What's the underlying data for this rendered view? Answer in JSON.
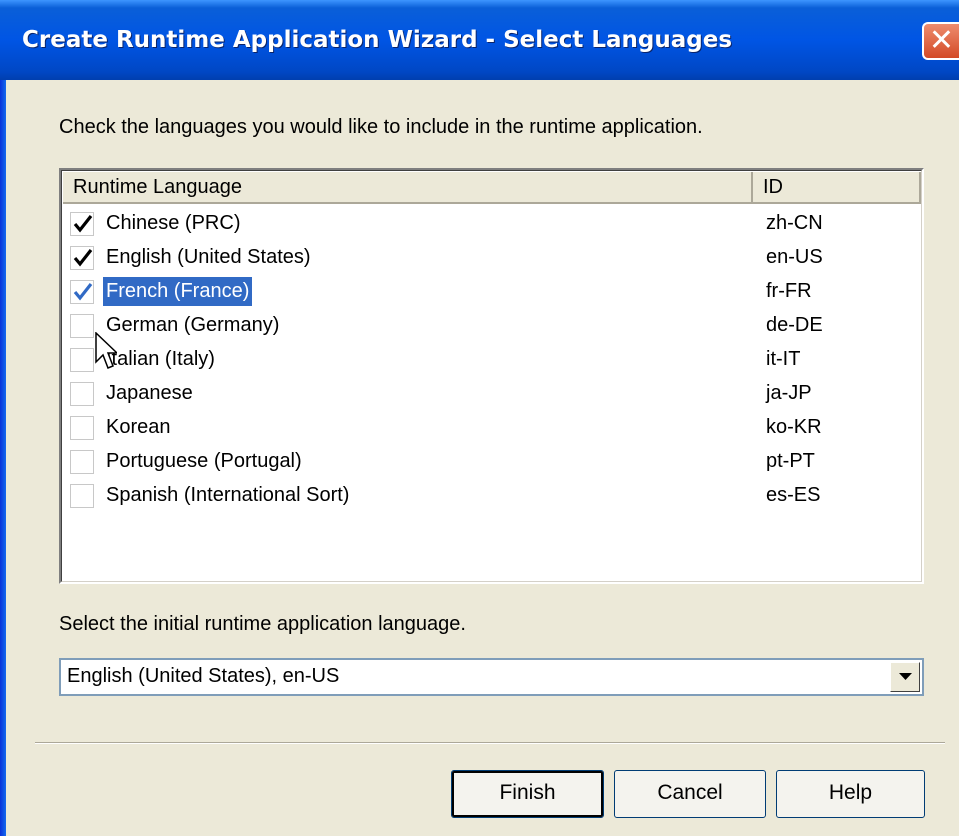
{
  "window": {
    "title": "Create Runtime Application Wizard - Select Languages",
    "close_glyph": "✕"
  },
  "instructions": "Check the languages you would like to include in the runtime application.",
  "list": {
    "columns": [
      "Runtime Language",
      "ID"
    ],
    "rows": [
      {
        "language": "Chinese (PRC)",
        "id": "zh-CN",
        "checked": true,
        "selected": false
      },
      {
        "language": "English (United States)",
        "id": "en-US",
        "checked": true,
        "selected": false
      },
      {
        "language": "French (France)",
        "id": "fr-FR",
        "checked": true,
        "selected": true
      },
      {
        "language": "German (Germany)",
        "id": "de-DE",
        "checked": false,
        "selected": false
      },
      {
        "language": "Italian (Italy)",
        "id": "it-IT",
        "checked": false,
        "selected": false
      },
      {
        "language": "Japanese",
        "id": "ja-JP",
        "checked": false,
        "selected": false
      },
      {
        "language": "Korean",
        "id": "ko-KR",
        "checked": false,
        "selected": false
      },
      {
        "language": "Portuguese (Portugal)",
        "id": "pt-PT",
        "checked": false,
        "selected": false
      },
      {
        "language": "Spanish (International Sort)",
        "id": "es-ES",
        "checked": false,
        "selected": false
      }
    ]
  },
  "initial_language_label": "Select the initial runtime application language.",
  "initial_language_value": "English (United States), en-US",
  "buttons": {
    "finish": "Finish",
    "cancel": "Cancel",
    "help": "Help"
  },
  "colors": {
    "selection": "#316ac5",
    "titlebar": "#0055e5",
    "close": "#d34a26"
  }
}
